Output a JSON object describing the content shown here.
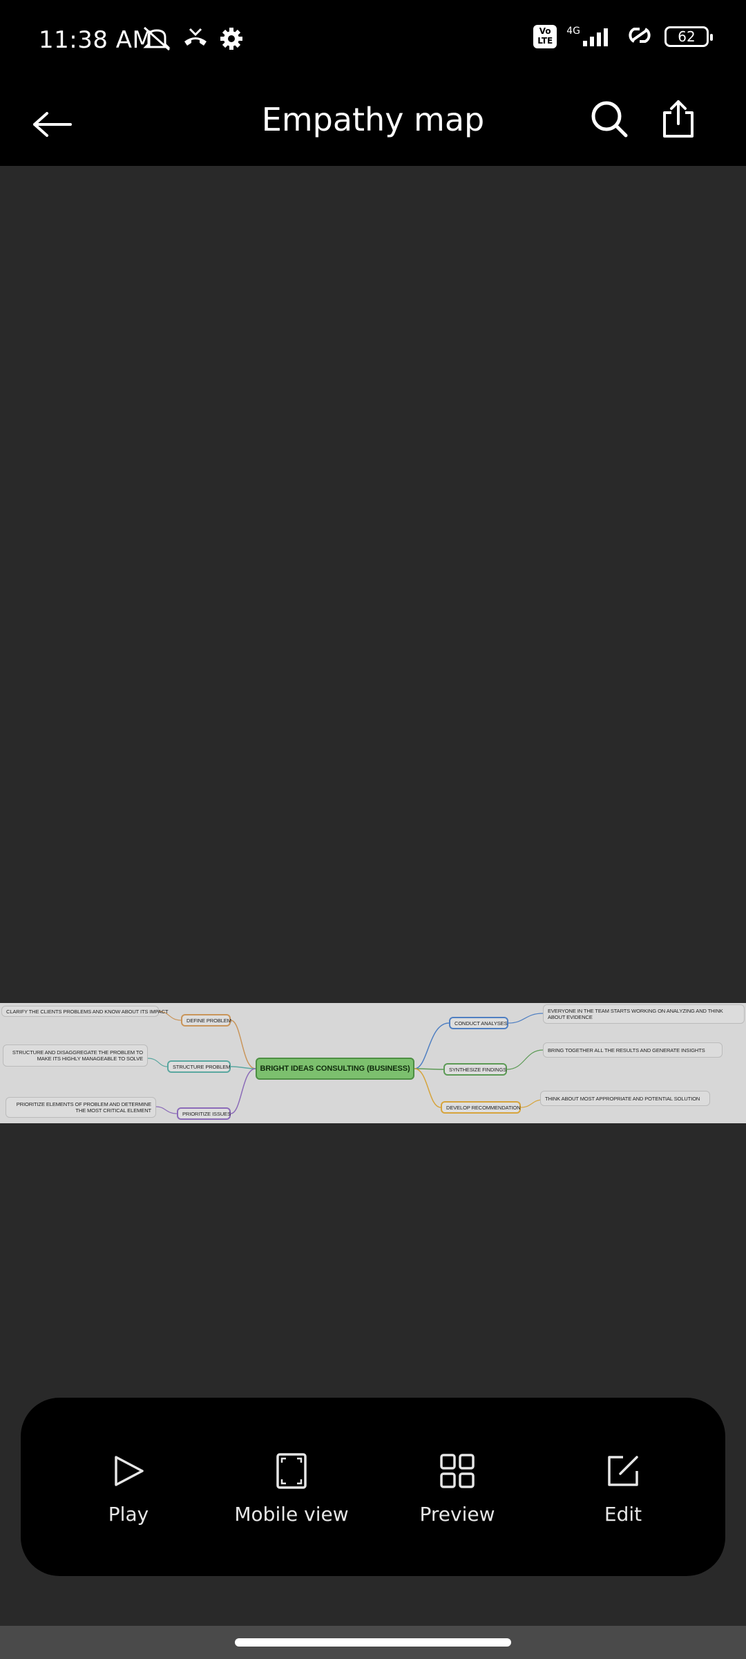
{
  "status_bar": {
    "time": "11:38 AM",
    "network": "4G",
    "volte": "Vo LTE",
    "battery": "62"
  },
  "header": {
    "title": "Empathy map"
  },
  "mindmap": {
    "center": "BRIGHT IDEAS CONSULTING (BUSINESS)",
    "left_branches": [
      {
        "label": "DEFINE PROBLEM",
        "detail": "CLARIFY THE CLIENTS PROBLEMS AND KNOW ABOUT ITS IMPACT"
      },
      {
        "label": "STRUCTURE PROBLEM",
        "detail": "STRUCTURE AND DISAGGREGATE THE PROBLEM TO MAKE ITS HIGHLY MANAGEABLE TO SOLVE"
      },
      {
        "label": "PRIORITIZE ISSUES",
        "detail": "PRIORITIZE ELEMENTS OF PROBLEM AND DETERMINE THE MOST CRITICAL ELEMENT"
      }
    ],
    "right_branches": [
      {
        "label": "CONDUCT ANALYSES",
        "detail": "EVERYONE IN THE TEAM STARTS WORKING ON ANALYZING AND THINK ABOUT EVIDENCE"
      },
      {
        "label": "SYNTHESIZE FINDINGS",
        "detail": "BRING TOGETHER ALL THE RESULTS AND  GENERATE INSIGHTS"
      },
      {
        "label": "DEVELOP RECOMMENDATION",
        "detail": "THINK ABOUT MOST APPROPRIATE AND POTENTIAL SOLUTION"
      }
    ]
  },
  "bottom_actions": [
    {
      "label": "Play",
      "icon": "play-icon"
    },
    {
      "label": "Mobile view",
      "icon": "mobile-view-icon"
    },
    {
      "label": "Preview",
      "icon": "grid-icon"
    },
    {
      "label": "Edit",
      "icon": "edit-icon"
    }
  ],
  "colors": {
    "background": "#292929",
    "bar": "#000000",
    "center_node": "#7cc06e",
    "line_define": "#c9955a",
    "line_structure": "#5aa7a0",
    "line_prioritize": "#8b6bb8",
    "line_conduct": "#4f7fc2",
    "line_synthesize": "#5c9a55",
    "line_develop": "#d6a43c"
  }
}
